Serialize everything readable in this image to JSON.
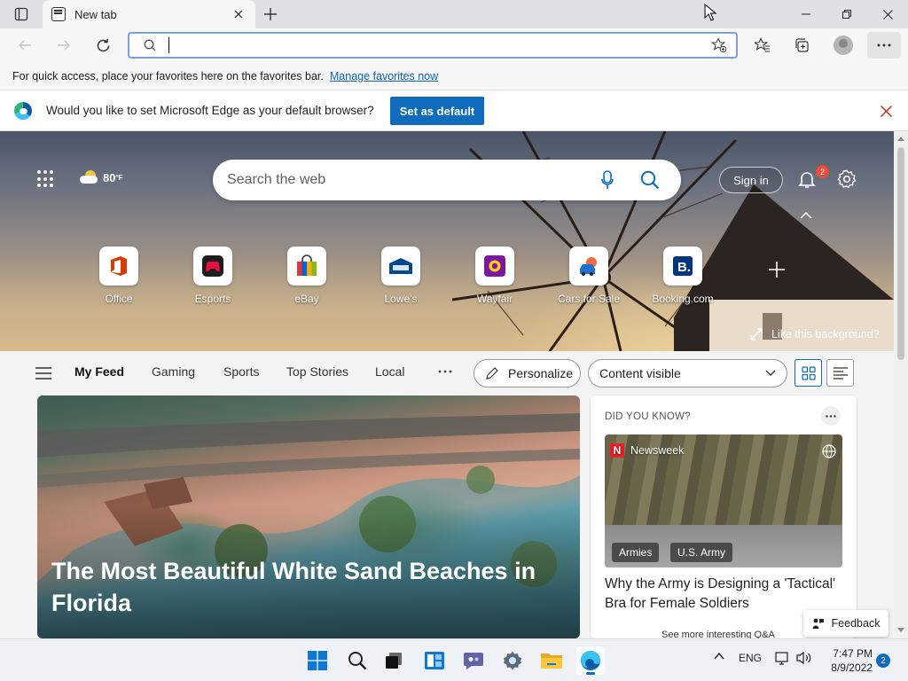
{
  "browser": {
    "tab_title": "New tab",
    "address_value": "",
    "favorites_bar_text": "For quick access, place your favorites here on the favorites bar.",
    "favorites_bar_link": "Manage favorites now"
  },
  "infobar": {
    "message": "Would you like to set Microsoft Edge as your default browser?",
    "button_label": "Set as default"
  },
  "hero": {
    "weather_temp": "80",
    "weather_unit": "°F",
    "search_placeholder": "Search the web",
    "sign_in_label": "Sign in",
    "notification_count": "2",
    "like_background_label": "Like this background?"
  },
  "quick_links": [
    {
      "label": "Office",
      "icon": "office-icon"
    },
    {
      "label": "Esports",
      "icon": "esports-icon"
    },
    {
      "label": "eBay",
      "icon": "ebay-icon"
    },
    {
      "label": "Lowe's",
      "icon": "lowes-icon"
    },
    {
      "label": "Wayfair",
      "icon": "wayfair-icon"
    },
    {
      "label": "Cars for Sale",
      "icon": "car-icon"
    },
    {
      "label": "Booking.com",
      "icon": "booking-icon"
    }
  ],
  "feed": {
    "tabs": [
      "My Feed",
      "Gaming",
      "Sports",
      "Top Stories",
      "Local"
    ],
    "personalize_label": "Personalize",
    "content_visibility": "Content visible"
  },
  "main_article": {
    "title": "The Most Beautiful White Sand Beaches in Florida"
  },
  "did_you_know": {
    "label": "DID YOU KNOW?",
    "source": "Newsweek",
    "tags": [
      "Armies",
      "U.S. Army"
    ],
    "headline": "Why the Army is Designing a 'Tactical' Bra for Female Soldiers",
    "footer": "See more interesting Q&A"
  },
  "feedback_label": "Feedback",
  "taskbar": {
    "language": "ENG",
    "time": "7:47 PM",
    "date": "8/9/2022",
    "notification_count": "2"
  },
  "colors": {
    "accent": "#0f6cbd",
    "close_red": "#c42b1c",
    "badge_red": "#e74c3c"
  }
}
